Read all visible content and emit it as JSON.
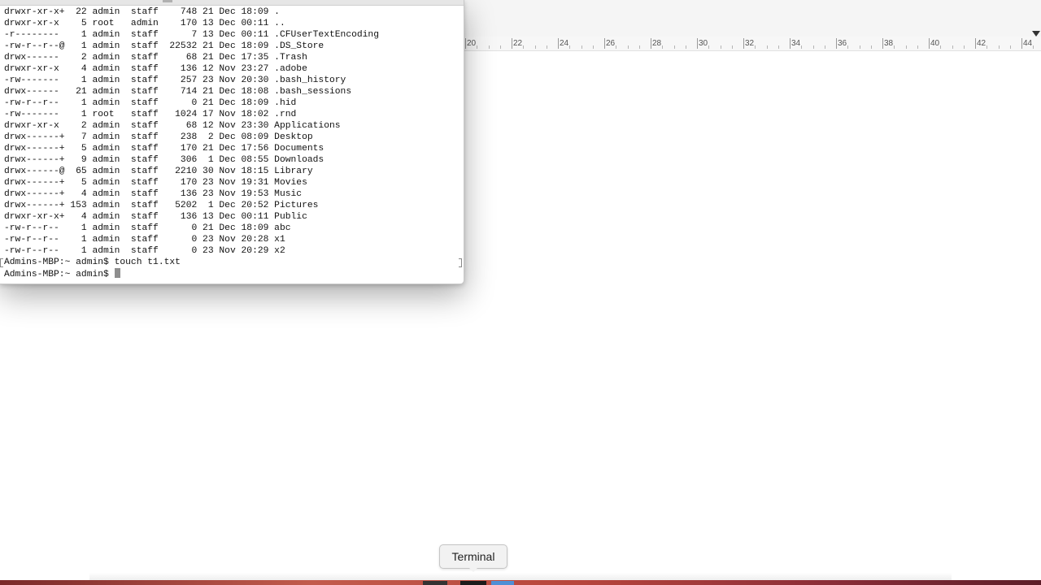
{
  "terminal": {
    "lines": [
      "drwxr-xr-x+  22 admin  staff    748 21 Dec 18:09 .",
      "drwxr-xr-x    5 root   admin    170 13 Dec 00:11 ..",
      "-r--------    1 admin  staff      7 13 Dec 00:11 .CFUserTextEncoding",
      "-rw-r--r--@   1 admin  staff  22532 21 Dec 18:09 .DS_Store",
      "drwx------    2 admin  staff     68 21 Dec 17:35 .Trash",
      "drwxr-xr-x    4 admin  staff    136 12 Nov 23:27 .adobe",
      "-rw-------    1 admin  staff    257 23 Nov 20:30 .bash_history",
      "drwx------   21 admin  staff    714 21 Dec 18:08 .bash_sessions",
      "-rw-r--r--    1 admin  staff      0 21 Dec 18:09 .hid",
      "-rw-------    1 root   staff   1024 17 Nov 18:02 .rnd",
      "drwxr-xr-x    2 admin  staff     68 12 Nov 23:30 Applications",
      "drwx------+   7 admin  staff    238  2 Dec 08:09 Desktop",
      "drwx------+   5 admin  staff    170 21 Dec 17:56 Documents",
      "drwx------+   9 admin  staff    306  1 Dec 08:55 Downloads",
      "drwx------@  65 admin  staff   2210 30 Nov 18:15 Library",
      "drwx------+   5 admin  staff    170 23 Nov 19:31 Movies",
      "drwx------+   4 admin  staff    136 23 Nov 19:53 Music",
      "drwx------+ 153 admin  staff   5202  1 Dec 20:52 Pictures",
      "drwxr-xr-x+   4 admin  staff    136 13 Dec 00:11 Public",
      "-rw-r--r--    1 admin  staff      0 21 Dec 18:09 abc",
      "-rw-r--r--    1 admin  staff      0 23 Nov 20:28 x1",
      "-rw-r--r--    1 admin  staff      0 23 Nov 20:29 x2",
      "Admins-MBP:~ admin$ touch t1.txt"
    ],
    "prompt": "Admins-MBP:~ admin$ "
  },
  "ruler": {
    "labels": [
      "20",
      "22",
      "24",
      "26",
      "28",
      "30",
      "32",
      "34",
      "36",
      "38",
      "40",
      "42",
      "44"
    ]
  },
  "dock": {
    "tooltip": "Terminal"
  }
}
